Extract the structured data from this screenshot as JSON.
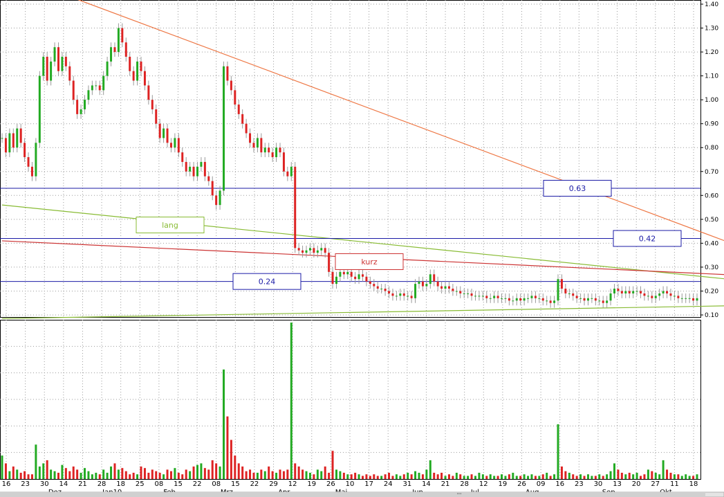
{
  "colors": {
    "up": "#22aa22",
    "down": "#dd2222",
    "grid": "#9a9a9a",
    "level_line": "#1a1aa6",
    "trend_long": "#88bb33",
    "trend_short": "#cc3333",
    "trend_top": "#ee7744",
    "trend_bottom": "#88bb33",
    "wick": "#999999"
  },
  "chart_data": {
    "type": "candlestick",
    "title": "",
    "xlabel": "",
    "ylabel": "",
    "ylim": [
      0.08,
      1.42
    ],
    "y_ticks": [
      0.1,
      0.2,
      0.3,
      0.4,
      0.5,
      0.6,
      0.7,
      0.8,
      0.9,
      1.0,
      1.1,
      1.2,
      1.3,
      1.4
    ],
    "y_tick_labels": [
      "0.10",
      "0.20",
      "0.30",
      "0.40",
      "0.50",
      "0.60",
      "0.70",
      "0.80",
      "0.90",
      "1.00",
      "1.10",
      "1.20",
      "1.30",
      "1.40"
    ],
    "x_tick_labels": [
      "16",
      "23",
      "30",
      "14",
      "21",
      "28",
      "18",
      "25",
      "08",
      "15",
      "22",
      "08",
      "15",
      "22",
      "29",
      "12",
      "19",
      "26",
      "10",
      "17",
      "24",
      "31",
      "14",
      "21",
      "28",
      "12",
      "19",
      "26",
      "09",
      "16",
      "23",
      "30",
      "13",
      "20",
      "27",
      "11",
      "18"
    ],
    "month_labels": [
      "Dez",
      "Jan10",
      "Feb",
      "Mrz",
      "Apr",
      "Mai",
      "Jun",
      "Jul",
      "Aug",
      "Sep",
      "Okt"
    ],
    "grid": true,
    "level_lines": [
      {
        "value": 0.63,
        "label": "0.63"
      },
      {
        "value": 0.42,
        "label": "0.42"
      },
      {
        "value": 0.24,
        "label": "0.24"
      }
    ],
    "trend_lines": [
      {
        "name": "lang",
        "from": [
          0,
          0.56
        ],
        "to": [
          218,
          0.21
        ]
      },
      {
        "name": "kurz",
        "from": [
          0,
          0.41
        ],
        "to": [
          218,
          0.25
        ]
      },
      {
        "name": "",
        "from": [
          20,
          1.42
        ],
        "to": [
          218,
          0.26
        ]
      },
      {
        "name": "",
        "from": [
          0,
          0.085
        ],
        "to": [
          218,
          0.145
        ]
      }
    ],
    "close": [
      0.84,
      0.78,
      0.86,
      0.8,
      0.88,
      0.82,
      0.76,
      0.72,
      0.68,
      0.82,
      1.1,
      1.18,
      1.08,
      1.16,
      1.22,
      1.12,
      1.18,
      1.14,
      1.08,
      1.0,
      0.94,
      0.96,
      1.0,
      1.04,
      1.06,
      1.06,
      1.04,
      1.1,
      1.16,
      1.22,
      1.2,
      1.3,
      1.24,
      1.18,
      1.12,
      1.08,
      1.16,
      1.12,
      1.06,
      1.0,
      0.96,
      0.9,
      0.84,
      0.88,
      0.82,
      0.8,
      0.84,
      0.78,
      0.74,
      0.7,
      0.72,
      0.68,
      0.72,
      0.74,
      0.68,
      0.66,
      0.6,
      0.56,
      0.62,
      1.14,
      1.08,
      1.04,
      0.98,
      0.94,
      0.9,
      0.86,
      0.82,
      0.8,
      0.84,
      0.78,
      0.8,
      0.78,
      0.76,
      0.8,
      0.78,
      0.7,
      0.68,
      0.72,
      0.38,
      0.37,
      0.36,
      0.37,
      0.38,
      0.36,
      0.37,
      0.38,
      0.36,
      0.28,
      0.23,
      0.26,
      0.28,
      0.27,
      0.28,
      0.26,
      0.25,
      0.27,
      0.26,
      0.24,
      0.23,
      0.22,
      0.21,
      0.21,
      0.2,
      0.19,
      0.18,
      0.18,
      0.19,
      0.18,
      0.18,
      0.17,
      0.23,
      0.24,
      0.22,
      0.23,
      0.27,
      0.24,
      0.22,
      0.21,
      0.22,
      0.21,
      0.2,
      0.2,
      0.19,
      0.19,
      0.19,
      0.18,
      0.18,
      0.18,
      0.18,
      0.17,
      0.17,
      0.18,
      0.17,
      0.17,
      0.17,
      0.16,
      0.16,
      0.17,
      0.16,
      0.17,
      0.17,
      0.18,
      0.17,
      0.17,
      0.16,
      0.16,
      0.15,
      0.16,
      0.25,
      0.21,
      0.19,
      0.19,
      0.18,
      0.17,
      0.17,
      0.16,
      0.17,
      0.17,
      0.16,
      0.16,
      0.15,
      0.16,
      0.19,
      0.21,
      0.2,
      0.19,
      0.2,
      0.19,
      0.2,
      0.2,
      0.19,
      0.18,
      0.18,
      0.17,
      0.18,
      0.19,
      0.2,
      0.19,
      0.18,
      0.18,
      0.17,
      0.17,
      0.17,
      0.17,
      0.16,
      0.17
    ],
    "volume_label_max": 100,
    "volume": [
      15,
      10,
      5,
      8,
      6,
      4,
      5,
      3,
      3,
      22,
      8,
      10,
      12,
      6,
      5,
      4,
      9,
      7,
      5,
      8,
      6,
      4,
      7,
      5,
      3,
      4,
      3,
      6,
      4,
      8,
      10,
      6,
      7,
      5,
      3,
      4,
      3,
      8,
      7,
      4,
      6,
      5,
      4,
      3,
      6,
      5,
      7,
      4,
      3,
      6,
      5,
      8,
      9,
      10,
      7,
      6,
      12,
      10,
      8,
      70,
      40,
      25,
      15,
      10,
      8,
      5,
      6,
      4,
      4,
      6,
      5,
      8,
      5,
      4,
      6,
      5,
      6,
      100,
      10,
      8,
      6,
      5,
      4,
      3,
      6,
      5,
      8,
      4,
      18,
      6,
      5,
      4,
      3,
      3,
      4,
      3,
      2,
      3,
      2,
      3,
      2,
      2,
      3,
      4,
      2,
      3,
      2,
      3,
      4,
      3,
      5,
      4,
      3,
      6,
      12,
      4,
      3,
      4,
      2,
      3,
      2,
      4,
      3,
      2,
      2,
      3,
      2,
      4,
      3,
      2,
      3,
      2,
      2,
      3,
      2,
      3,
      4,
      2,
      2,
      3,
      2,
      3,
      2,
      2,
      3,
      4,
      2,
      3,
      35,
      8,
      5,
      4,
      3,
      2,
      3,
      2,
      3,
      2,
      2,
      3,
      2,
      3,
      5,
      10,
      6,
      4,
      3,
      4,
      3,
      4,
      2,
      3,
      6,
      5,
      4,
      3,
      12,
      6,
      4,
      3,
      3,
      2,
      3,
      2,
      2,
      3
    ]
  },
  "labels": {
    "lang": "lang",
    "kurz": "kurz",
    "scroll_grip": "'''"
  }
}
